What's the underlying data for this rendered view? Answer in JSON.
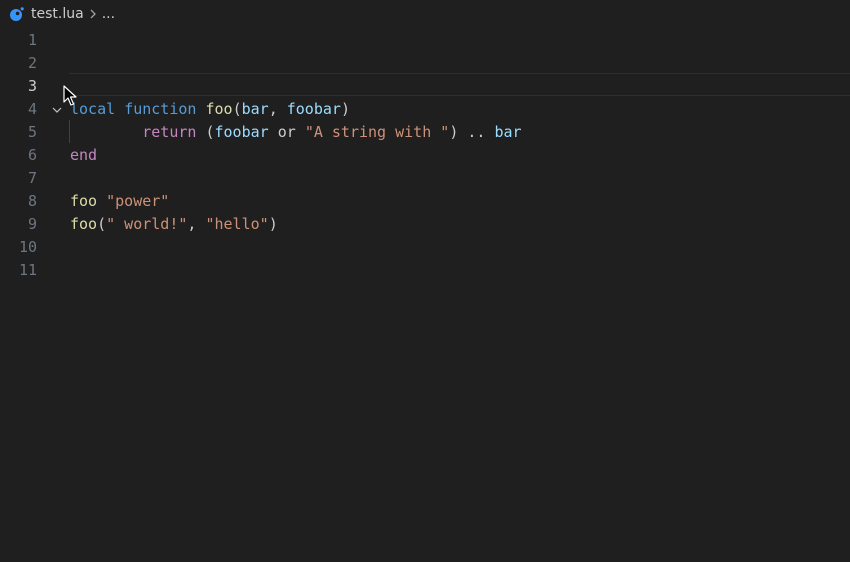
{
  "breadcrumb": {
    "file_icon": "lua-icon",
    "filename": "test.lua",
    "separator_icon": "chevron-right-icon",
    "more": "..."
  },
  "editor": {
    "active_line": 3,
    "lines": [
      {
        "number": "1",
        "tokens": []
      },
      {
        "number": "2",
        "tokens": []
      },
      {
        "number": "3",
        "tokens": []
      },
      {
        "number": "4",
        "fold_icon": "chevron-down-icon",
        "tokens": [
          {
            "text": "local",
            "type": "kw"
          },
          {
            "text": " ",
            "type": "plain"
          },
          {
            "text": "function",
            "type": "kw"
          },
          {
            "text": " ",
            "type": "plain"
          },
          {
            "text": "foo",
            "type": "fn"
          },
          {
            "text": "(",
            "type": "plain"
          },
          {
            "text": "bar",
            "type": "var"
          },
          {
            "text": ", ",
            "type": "plain"
          },
          {
            "text": "foobar",
            "type": "var"
          },
          {
            "text": ")",
            "type": "plain"
          }
        ]
      },
      {
        "number": "5",
        "tokens": [
          {
            "text": "        ",
            "type": "plain"
          },
          {
            "text": "return",
            "type": "ctl"
          },
          {
            "text": " (",
            "type": "plain"
          },
          {
            "text": "foobar",
            "type": "var"
          },
          {
            "text": " or ",
            "type": "plain"
          },
          {
            "text": "\"A string with \"",
            "type": "str"
          },
          {
            "text": ") .. ",
            "type": "plain"
          },
          {
            "text": "bar",
            "type": "var"
          }
        ]
      },
      {
        "number": "6",
        "tokens": [
          {
            "text": "end",
            "type": "ctl"
          }
        ]
      },
      {
        "number": "7",
        "tokens": []
      },
      {
        "number": "8",
        "tokens": [
          {
            "text": "foo",
            "type": "fn"
          },
          {
            "text": " ",
            "type": "plain"
          },
          {
            "text": "\"power\"",
            "type": "str"
          }
        ]
      },
      {
        "number": "9",
        "tokens": [
          {
            "text": "foo",
            "type": "fn"
          },
          {
            "text": "(",
            "type": "plain"
          },
          {
            "text": "\" world!\"",
            "type": "str"
          },
          {
            "text": ", ",
            "type": "plain"
          },
          {
            "text": "\"hello\"",
            "type": "str"
          },
          {
            "text": ")",
            "type": "plain"
          }
        ]
      },
      {
        "number": "10",
        "tokens": []
      },
      {
        "number": "11",
        "tokens": []
      }
    ]
  },
  "colors": {
    "background": "#1f1f1f",
    "keyword": "#569cd6",
    "control": "#c586c0",
    "function": "#dcdcaa",
    "variable": "#9cdcfe",
    "string": "#ce9178"
  }
}
